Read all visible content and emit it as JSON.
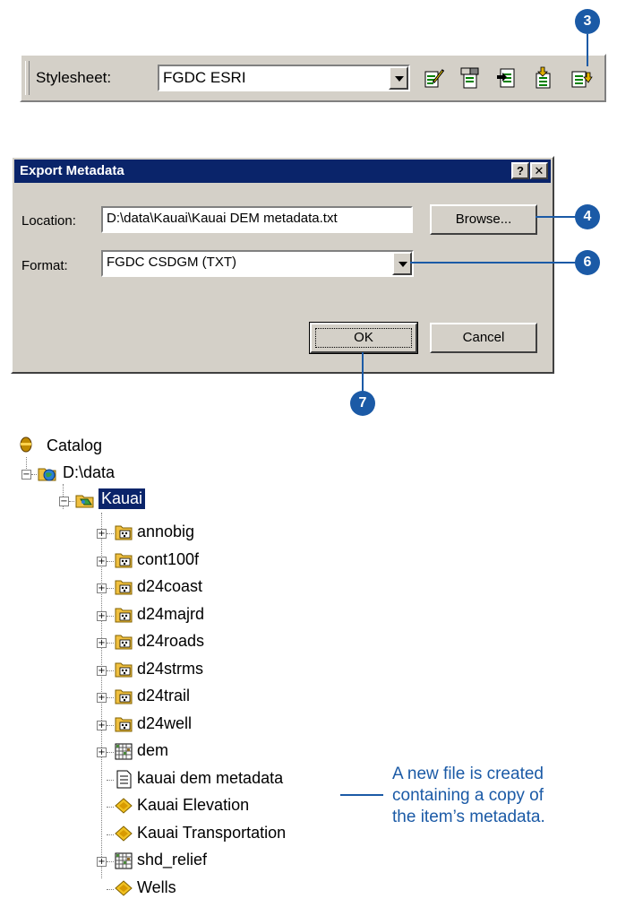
{
  "toolbar": {
    "stylesheet_label": "Stylesheet:",
    "stylesheet_value": "FGDC ESRI",
    "tools": [
      {
        "icon": "edit-metadata-icon"
      },
      {
        "icon": "metadata-properties-icon"
      },
      {
        "icon": "import-metadata-icon"
      },
      {
        "icon": "export-metadata-icon"
      },
      {
        "icon": "create-update-metadata-icon"
      }
    ]
  },
  "callouts": {
    "c3": "3",
    "c4": "4",
    "c6": "6",
    "c7": "7"
  },
  "dialog": {
    "title": "Export Metadata",
    "help_button": "?",
    "close_button": "✕",
    "location_label": "Location:",
    "location_value": "D:\\data\\Kauai\\Kauai DEM metadata.txt",
    "browse_button": "Browse...",
    "format_label": "Format:",
    "format_value": "FGDC CSDGM (TXT)",
    "ok_button": "OK",
    "cancel_button": "Cancel"
  },
  "tree": {
    "root": "Catalog",
    "drive": "D:\\data",
    "folder": "Kauai",
    "items": [
      {
        "label": "annobig",
        "icon": "coverage-icon"
      },
      {
        "label": "cont100f",
        "icon": "coverage-icon"
      },
      {
        "label": "d24coast",
        "icon": "coverage-icon"
      },
      {
        "label": "d24majrd",
        "icon": "coverage-icon"
      },
      {
        "label": "d24roads",
        "icon": "coverage-icon"
      },
      {
        "label": "d24strms",
        "icon": "coverage-icon"
      },
      {
        "label": "d24trail",
        "icon": "coverage-icon"
      },
      {
        "label": "d24well",
        "icon": "coverage-icon"
      },
      {
        "label": "dem",
        "icon": "raster-icon"
      },
      {
        "label": "kauai dem metadata",
        "icon": "text-file-icon"
      },
      {
        "label": "Kauai Elevation",
        "icon": "layer-file-icon"
      },
      {
        "label": "Kauai Transportation",
        "icon": "layer-file-icon"
      },
      {
        "label": "shd_relief",
        "icon": "raster-icon"
      },
      {
        "label": "Wells",
        "icon": "layer-file-icon"
      }
    ]
  },
  "annotation": {
    "line1": "A new file is created",
    "line2": "containing a copy of",
    "line3": "the item’s metadata."
  },
  "colors": {
    "callout": "#1b5aa6",
    "title_bar": "#0a246a",
    "face": "#d4d0c8"
  }
}
